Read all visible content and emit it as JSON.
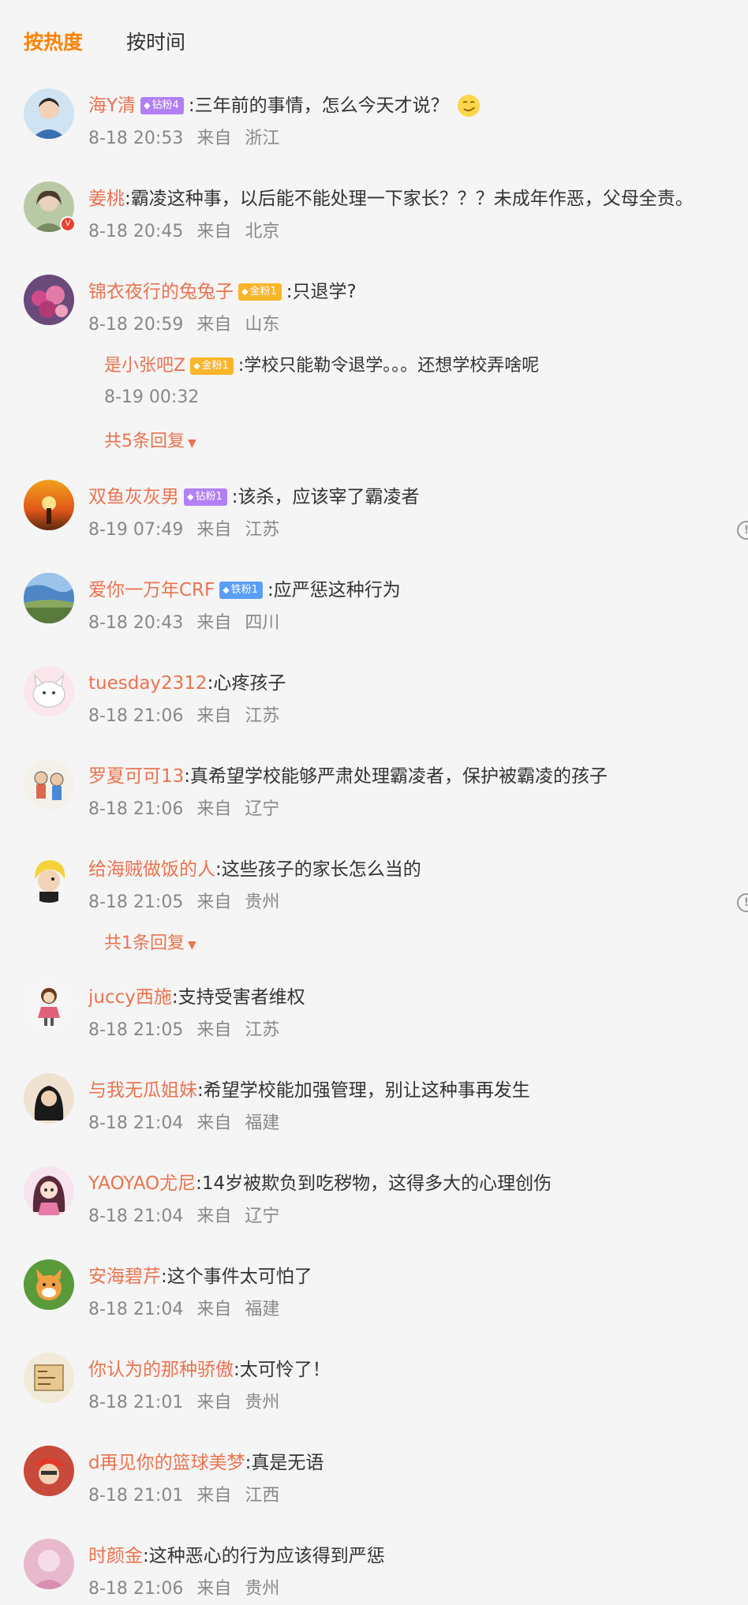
{
  "tabs": {
    "hot": "按热度",
    "time": "按时间"
  },
  "comments": [
    {
      "name": "海Y清",
      "badge": "钻粉4",
      "badge_type": "zuan",
      "text": "三年前的事情，怎么今天才说？",
      "time": "8-18 20:53",
      "from": "来自",
      "loc": "浙江",
      "emoji": "smirk-emoji"
    },
    {
      "name": "姜桃",
      "text": "霸凌这种事，以后能不能处理一下家长？？？未成年作恶，父母全责。",
      "time": "8-18 20:45",
      "from": "来自",
      "loc": "北京",
      "verified": "V"
    },
    {
      "name": "锦衣夜行的兔兔子",
      "badge": "金粉1",
      "badge_type": "jin",
      "text": "只退学?",
      "time": "8-18 20:59",
      "from": "来自",
      "loc": "山东",
      "reply": {
        "name": "是小张吧Z",
        "badge": "金粉1",
        "badge_type": "jin",
        "text": "学校只能勒令退学。。。还想学校弄啥呢",
        "time": "8-19 00:32"
      },
      "more": "共5条回复"
    },
    {
      "name": "双鱼灰灰男",
      "badge": "钻粉1",
      "badge_type": "zuan",
      "text": "该杀，应该宰了霸凌者",
      "time": "8-19 07:49",
      "from": "来自",
      "loc": "江苏",
      "report": "!"
    },
    {
      "name": "爱你一万年CRF",
      "badge": "铁粉1",
      "badge_type": "tie",
      "text": "应严惩这种行为",
      "time": "8-18 20:43",
      "from": "来自",
      "loc": "四川"
    },
    {
      "name": "tuesday2312",
      "text": "心疼孩子",
      "time": "8-18 21:06",
      "from": "来自",
      "loc": "江苏"
    },
    {
      "name": "罗夏可可13",
      "text": "真希望学校能够严肃处理霸凌者，保护被霸凌的孩子",
      "time": "8-18 21:06",
      "from": "来自",
      "loc": "辽宁"
    },
    {
      "name": "给海贼做饭的人",
      "text": "这些孩子的家长怎么当的",
      "time": "8-18 21:05",
      "from": "来自",
      "loc": "贵州",
      "report": "!",
      "more": "共1条回复"
    },
    {
      "name": "juccy西施",
      "text": "支持受害者维权",
      "time": "8-18 21:05",
      "from": "来自",
      "loc": "江苏"
    },
    {
      "name": "与我无瓜姐妹",
      "text": "希望学校能加强管理，别让这种事再发生",
      "time": "8-18 21:04",
      "from": "来自",
      "loc": "福建"
    },
    {
      "name": "YAOYAO尤尼",
      "text": "14岁被欺负到吃秽物，这得多大的心理创伤",
      "time": "8-18 21:04",
      "from": "来自",
      "loc": "辽宁"
    },
    {
      "name": "安海碧芹",
      "text": "这个事件太可怕了",
      "time": "8-18 21:04",
      "from": "来自",
      "loc": "福建"
    },
    {
      "name": "你认为的那种骄傲",
      "text": "太可怜了！",
      "time": "8-18 21:01",
      "from": "来自",
      "loc": "贵州"
    },
    {
      "name": "d再见你的篮球美梦",
      "text": "真是无语",
      "time": "8-18 21:01",
      "from": "来自",
      "loc": "江西"
    },
    {
      "name": "时颜金",
      "text": "这种恶心的行为应该得到严惩",
      "time": "8-18 21:06",
      "from": "来自",
      "loc": "贵州"
    }
  ],
  "colors": {
    "accent": "#ff8200",
    "username": "#eb7350",
    "meta": "#888888",
    "background": "#f5f5f5"
  }
}
